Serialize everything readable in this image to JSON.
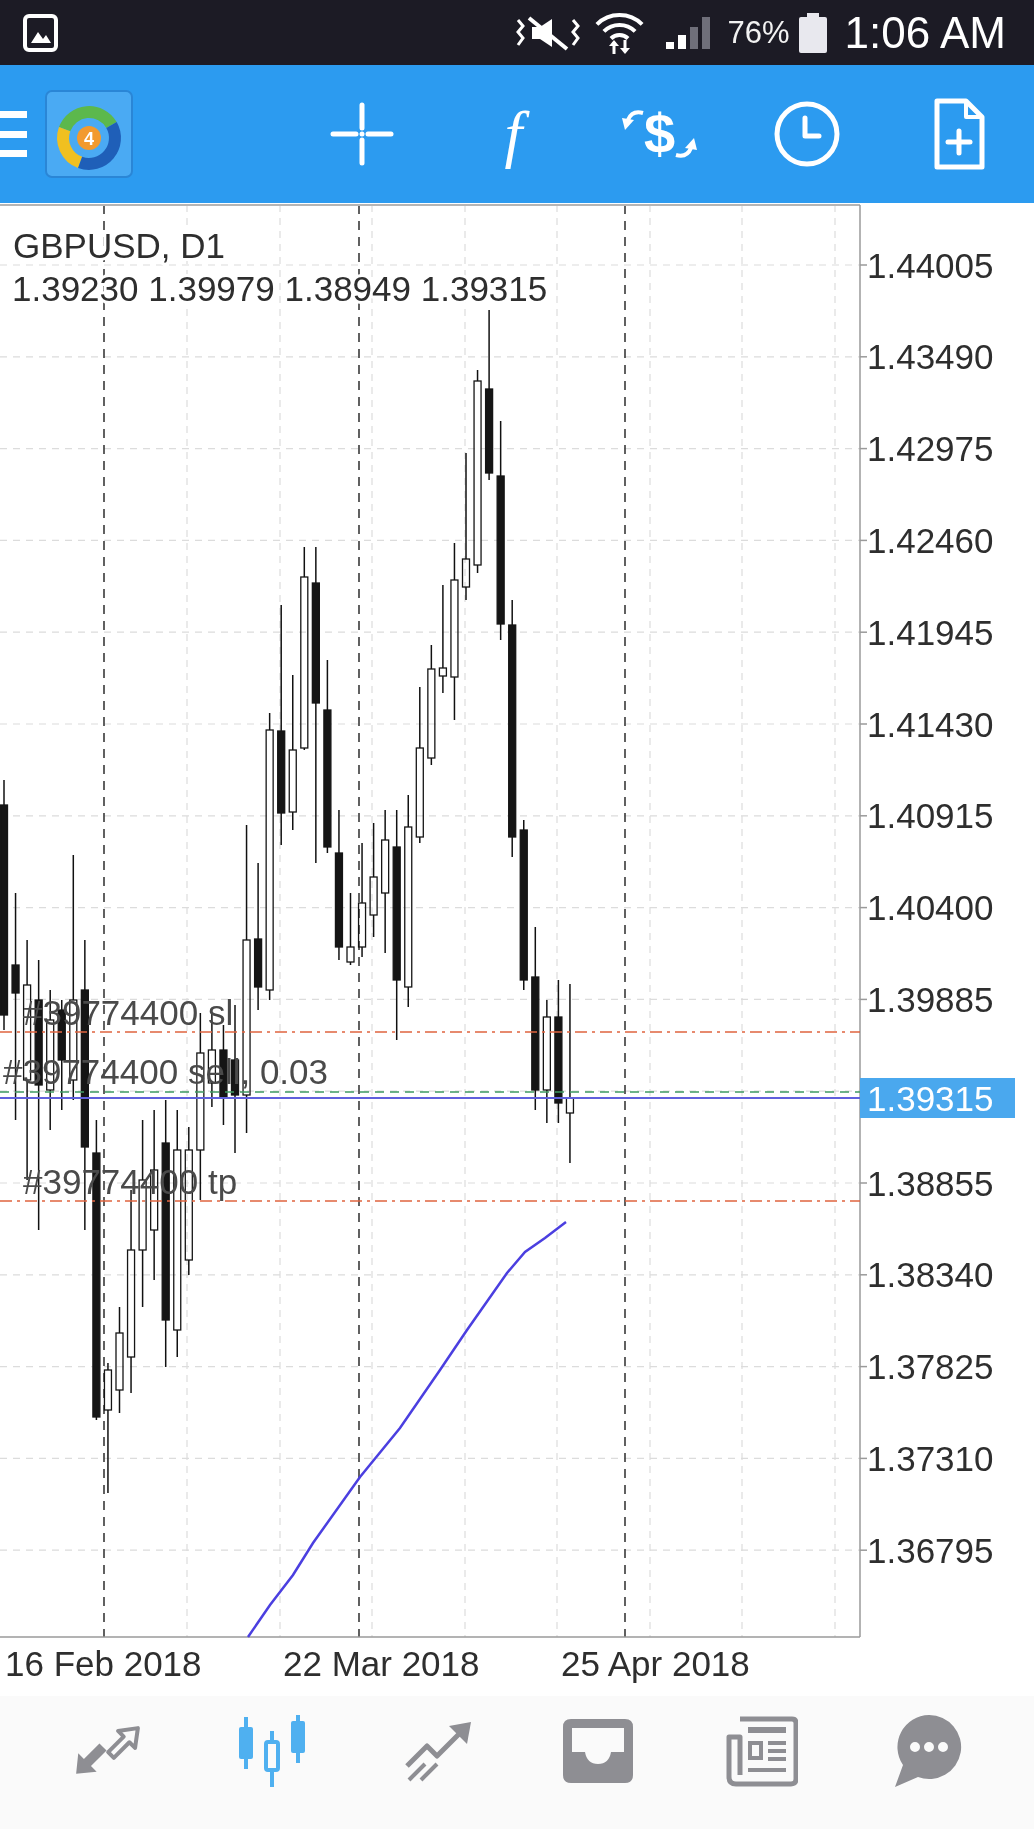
{
  "status_bar": {
    "battery": "76%",
    "time": "1:06 AM"
  },
  "toolbar": {
    "logo_badge": "4",
    "function_glyph": "f",
    "trade_glyph": "$"
  },
  "chart": {
    "symbol": "GBPUSD, D1",
    "ohlc": "1.39230 1.39979 1.38949 1.39315",
    "price_labels": [
      "1.44005",
      "1.43490",
      "1.42975",
      "1.42460",
      "1.41945",
      "1.41430",
      "1.40915",
      "1.40400",
      "1.39885",
      "1.38855",
      "1.38340",
      "1.37825",
      "1.37310",
      "1.36795"
    ],
    "current_price": "1.39315",
    "orders": [
      {
        "kind": "stop_loss",
        "label": "#39774400 sl"
      },
      {
        "kind": "entry",
        "label": "#39774400 sell, 0.03"
      },
      {
        "kind": "take_profit",
        "label": "#39774400 tp"
      }
    ],
    "date_labels": [
      "16 Feb 2018",
      "22 Mar 2018",
      "25 Apr 2018"
    ]
  },
  "bottom_nav": [
    {
      "kind": "arrows",
      "selected": false
    },
    {
      "kind": "candles",
      "selected": true
    },
    {
      "kind": "trend",
      "selected": false
    },
    {
      "kind": "tray",
      "selected": false
    },
    {
      "kind": "newspaper",
      "selected": false
    },
    {
      "kind": "chat",
      "selected": false
    }
  ]
}
